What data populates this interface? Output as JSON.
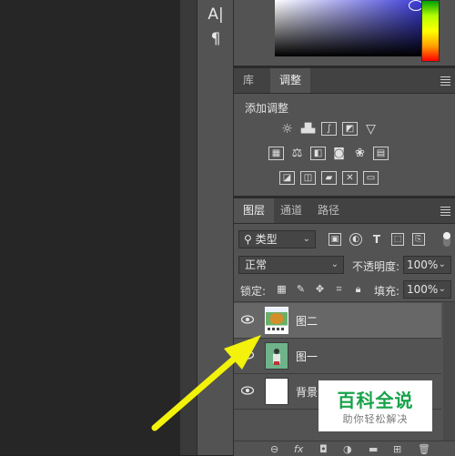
{
  "tools": {
    "text_glyph": "A|",
    "paragraph_glyph": "¶"
  },
  "adjust_panel": {
    "tabs": [
      {
        "label": "库"
      },
      {
        "label": "调整"
      }
    ],
    "title": "添加调整"
  },
  "layers_panel": {
    "tabs": [
      {
        "label": "图层"
      },
      {
        "label": "通道"
      },
      {
        "label": "路径"
      }
    ],
    "filter_kind": "类型",
    "blend_mode": "正常",
    "opacity_label": "不透明度:",
    "opacity_value": "100%",
    "lock_label": "锁定:",
    "fill_label": "填充:",
    "fill_value": "100%",
    "layers": [
      {
        "name": "图二",
        "selected": true
      },
      {
        "name": "图一",
        "selected": false
      },
      {
        "name": "背景",
        "selected": false
      }
    ]
  },
  "watermark": {
    "title": "百科全说",
    "subtitle": "助你轻松解决"
  },
  "colors": {
    "highlight_arrow": "#f2f20a",
    "watermark_green": "#17a34a",
    "panel_bg": "#535353"
  }
}
